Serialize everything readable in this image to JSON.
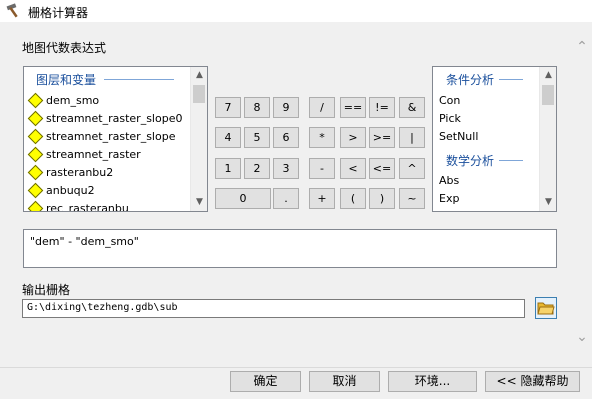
{
  "window": {
    "title": "栅格计算器",
    "icon": "hammer-icon"
  },
  "sections": {
    "expression_label": "地图代数表达式",
    "output_label": "输出栅格"
  },
  "layers_panel": {
    "header": "图层和变量",
    "items": [
      "dem_smo",
      "streamnet_raster_slope0",
      "streamnet_raster_slope",
      "streamnet_raster",
      "rasteranbu2",
      "anbuqu2",
      "rec_rasteranbu"
    ]
  },
  "calculator": {
    "rows": [
      [
        "7",
        "8",
        "9",
        "/",
        "==",
        "!=",
        "&"
      ],
      [
        "4",
        "5",
        "6",
        "*",
        ">",
        ">=",
        "|"
      ],
      [
        "1",
        "2",
        "3",
        "-",
        "<",
        "<=",
        "^"
      ],
      [
        "0",
        ".",
        "+",
        "(",
        ")",
        "~"
      ]
    ]
  },
  "functions_panel": {
    "header_conditional": "条件分析",
    "conditional": [
      "Con",
      "Pick",
      "SetNull"
    ],
    "header_math": "数学分析",
    "math": [
      "Abs",
      "Exp"
    ]
  },
  "expression": "\"dem\" - \"dem_smo\"",
  "output": {
    "value": "G:\\dixing\\tezheng.gdb\\sub",
    "browse_icon": "folder-open-icon"
  },
  "buttons": {
    "ok": "确定",
    "cancel": "取消",
    "environments": "环境...",
    "hide_help": "<< 隐藏帮助"
  },
  "colors": {
    "layer_diamond": "#ffff00",
    "panel_header": "#1a4f9c",
    "folder_icon": "#e8b830"
  }
}
